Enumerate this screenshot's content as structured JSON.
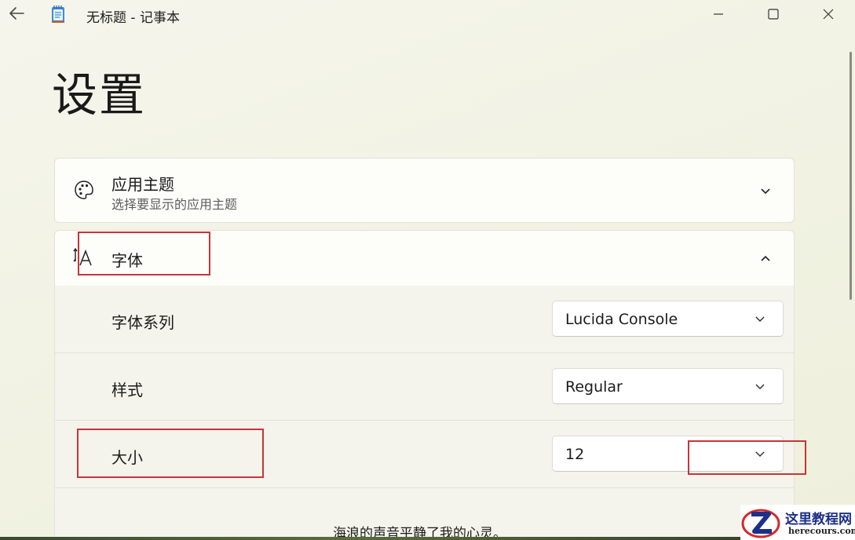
{
  "window": {
    "title": "无标题 - 记事本",
    "icons": {
      "back": "arrow-left-icon",
      "app": "notepad-icon",
      "minimize": "minimize-icon",
      "maximize": "maximize-icon",
      "close": "close-icon"
    }
  },
  "page": {
    "title": "设置"
  },
  "sections": {
    "theme": {
      "title": "应用主题",
      "subtitle": "选择要显示的应用主题",
      "icon": "palette-icon",
      "expanded": false
    },
    "font": {
      "title": "字体",
      "icon": "font-icon",
      "expanded": true,
      "rows": [
        {
          "label": "字体系列",
          "value": "Lucida Console"
        },
        {
          "label": "样式",
          "value": "Regular"
        },
        {
          "label": "大小",
          "value": "12"
        }
      ],
      "preview": "海浪的声音平静了我的心灵。"
    }
  },
  "annotations": {
    "highlight_color": "#c8343a"
  },
  "watermark": {
    "text": "这里教程网",
    "domain": "herecours.com"
  },
  "colors": {
    "background": "#f3f4e6",
    "card": "#fdfdf9",
    "sub_row": "#f4f4ec",
    "text": "#1b1b1b",
    "secondary_text": "#5d5d5d"
  }
}
